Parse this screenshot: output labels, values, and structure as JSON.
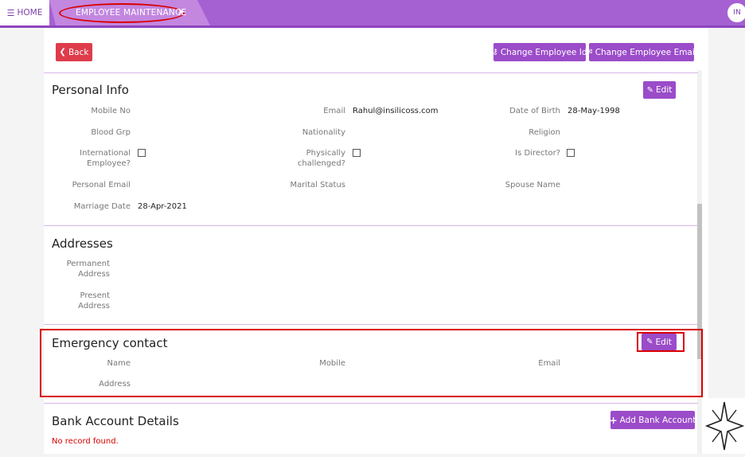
{
  "topbar": {
    "home_label": "HOME",
    "breadcrumb_label": "EMPLOYEE MAINTENANCE",
    "avatar_initials": "IN"
  },
  "actions": {
    "back_label": "Back",
    "change_id_label": "Change Employee Id",
    "change_email_label": "Change Employee Email"
  },
  "personal_info": {
    "title": "Personal Info",
    "edit_label": "Edit",
    "mobile_no_label": "Mobile No",
    "email_label": "Email",
    "email_value": "Rahul@insilicoss.com",
    "dob_label": "Date of Birth",
    "dob_value": "28-May-1998",
    "blood_grp_label": "Blood Grp",
    "nationality_label": "Nationality",
    "religion_label": "Religion",
    "intl_employee_label_1": "International",
    "intl_employee_label_2": "Employee?",
    "phys_challenged_label_1": "Physically",
    "phys_challenged_label_2": "challenged?",
    "is_director_label": "Is Director?",
    "personal_email_label": "Personal Email",
    "marital_status_label": "Marital Status",
    "spouse_name_label": "Spouse Name",
    "marriage_date_label": "Marriage Date",
    "marriage_date_value": "28-Apr-2021"
  },
  "addresses": {
    "title": "Addresses",
    "permanent_label_1": "Permanent",
    "permanent_label_2": "Address",
    "present_label_1": "Present",
    "present_label_2": "Address"
  },
  "emergency_contact": {
    "title": "Emergency contact",
    "edit_label": "Edit",
    "name_label": "Name",
    "mobile_label": "Mobile",
    "email_label": "Email",
    "address_label": "Address"
  },
  "bank_account": {
    "title": "Bank Account Details",
    "add_label": "Add Bank Account",
    "empty_text": "No record found."
  },
  "colors": {
    "brand_purple": "#a561d2",
    "button_purple": "#9b4cc9",
    "back_red": "#de3c4b",
    "annotation_red": "#d90000"
  }
}
